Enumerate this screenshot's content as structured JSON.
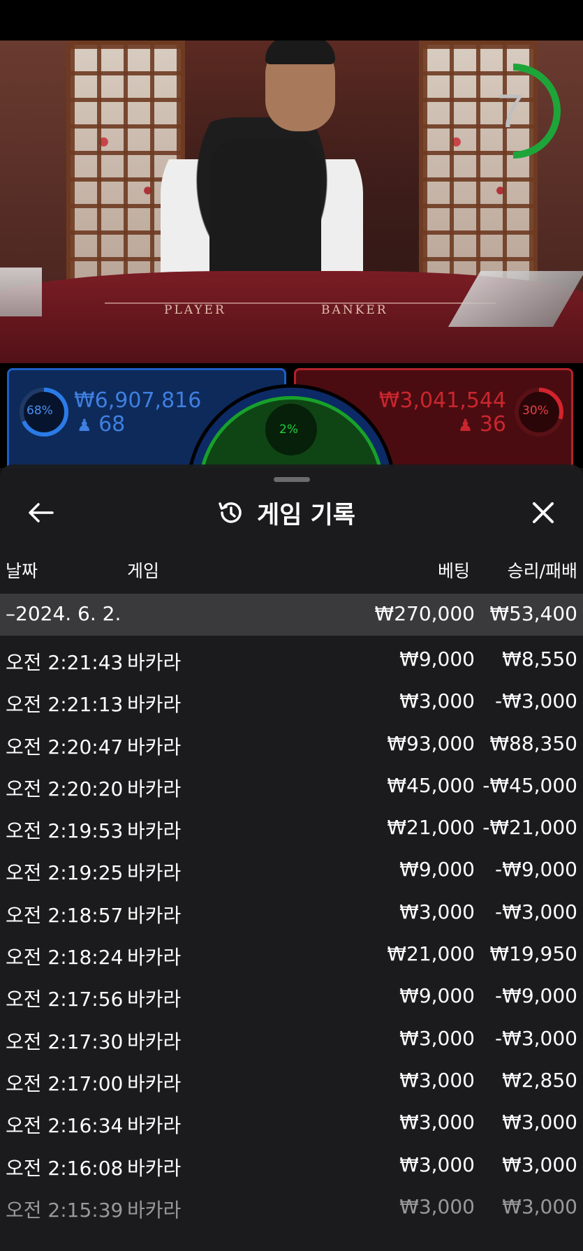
{
  "video": {
    "table_left_label": "PLAYER",
    "table_right_label": "BANKER",
    "countdown": "7",
    "countdown_ring_color": "#1ea53a"
  },
  "bets": {
    "player": {
      "percent": "68%",
      "amount": "₩6,907,816",
      "count": "68",
      "color": "#3f7fe0"
    },
    "tie": {
      "percent": "2%",
      "color": "#20d040"
    },
    "banker": {
      "percent": "30%",
      "amount": "₩3,041,544",
      "count": "36",
      "color": "#c9262e"
    }
  },
  "modal": {
    "title": "게임 기록",
    "columns": {
      "date": "날짜",
      "game": "게임",
      "bet": "베팅",
      "result": "승리/패배"
    },
    "summary": {
      "date": "–2024. 6. 2.",
      "bet": "₩270,000",
      "result": "₩53,400"
    },
    "rows": [
      {
        "time": "오전 2:21:43",
        "game": "바카라",
        "bet": "₩9,000",
        "result": "₩8,550"
      },
      {
        "time": "오전 2:21:13",
        "game": "바카라",
        "bet": "₩3,000",
        "result": "-₩3,000"
      },
      {
        "time": "오전 2:20:47",
        "game": "바카라",
        "bet": "₩93,000",
        "result": "₩88,350"
      },
      {
        "time": "오전 2:20:20",
        "game": "바카라",
        "bet": "₩45,000",
        "result": "-₩45,000"
      },
      {
        "time": "오전 2:19:53",
        "game": "바카라",
        "bet": "₩21,000",
        "result": "-₩21,000"
      },
      {
        "time": "오전 2:19:25",
        "game": "바카라",
        "bet": "₩9,000",
        "result": "-₩9,000"
      },
      {
        "time": "오전 2:18:57",
        "game": "바카라",
        "bet": "₩3,000",
        "result": "-₩3,000"
      },
      {
        "time": "오전 2:18:24",
        "game": "바카라",
        "bet": "₩21,000",
        "result": "₩19,950"
      },
      {
        "time": "오전 2:17:56",
        "game": "바카라",
        "bet": "₩9,000",
        "result": "-₩9,000"
      },
      {
        "time": "오전 2:17:30",
        "game": "바카라",
        "bet": "₩3,000",
        "result": "-₩3,000"
      },
      {
        "time": "오전 2:17:00",
        "game": "바카라",
        "bet": "₩3,000",
        "result": "₩2,850"
      },
      {
        "time": "오전 2:16:34",
        "game": "바카라",
        "bet": "₩3,000",
        "result": "₩3,000"
      },
      {
        "time": "오전 2:16:08",
        "game": "바카라",
        "bet": "₩3,000",
        "result": "₩3,000"
      },
      {
        "time": "오전 2:15:39",
        "game": "바카라",
        "bet": "₩3,000",
        "result": "₩3,000"
      }
    ],
    "icons": {
      "back": "arrow-left-icon",
      "history": "history-icon",
      "close": "close-icon"
    }
  }
}
